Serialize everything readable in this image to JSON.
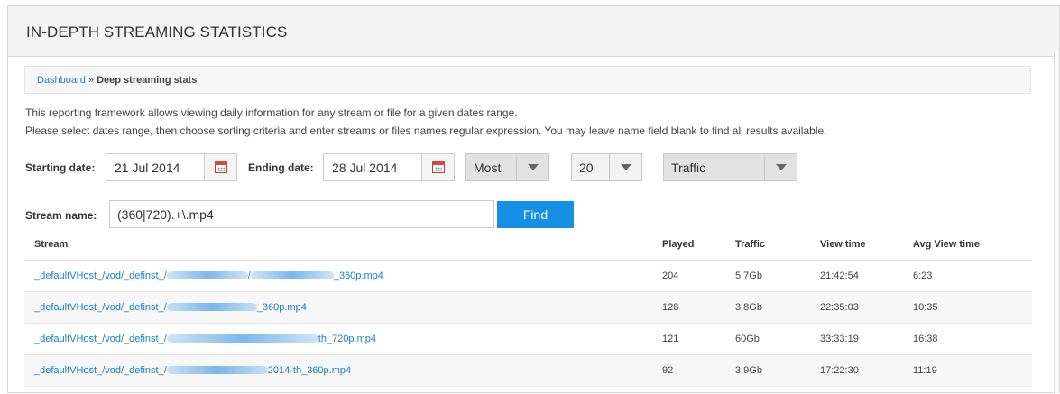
{
  "header": {
    "title": "IN-DEPTH STREAMING STATISTICS"
  },
  "breadcrumb": {
    "home": "Dashboard",
    "separator": "»",
    "current": "Deep streaming stats"
  },
  "description": {
    "line1": "This reporting framework allows viewing daily information for any stream or file for a given dates range.",
    "line2": "Please select dates range, then choose sorting criteria and enter streams or files names regular expression. You may leave name field blank to find all results available."
  },
  "filters": {
    "start_label": "Starting date:",
    "start_value": "21 Jul 2014",
    "end_label": "Ending date:",
    "end_value": "28 Jul 2014",
    "order_value": "Most",
    "count_value": "20",
    "criteria_value": "Traffic",
    "stream_label": "Stream name:",
    "stream_value": "(360|720).+\\.mp4",
    "find_label": "Find"
  },
  "table": {
    "columns": [
      "Stream",
      "Played",
      "Traffic",
      "View time",
      "Avg View time"
    ],
    "rows": [
      {
        "stream_prefix": "_defaultVHost_/vod/_definst_/",
        "stream_suffix": "_360p.mp4",
        "played": "204",
        "traffic": "5.7Gb",
        "view_time": "21:42:54",
        "avg_view_time": "6:23"
      },
      {
        "stream_prefix": "_defaultVHost_/vod/_definst_/",
        "stream_suffix": "_360p.mp4",
        "played": "128",
        "traffic": "3.8Gb",
        "view_time": "22:35:03",
        "avg_view_time": "10:35"
      },
      {
        "stream_prefix": "_defaultVHost_/vod/_definst_/",
        "stream_suffix": "th_720p.mp4",
        "played": "121",
        "traffic": "60Gb",
        "view_time": "33:33:19",
        "avg_view_time": "16:38"
      },
      {
        "stream_prefix": "_defaultVHost_/vod/_definst_/",
        "stream_suffix": "2014-th_360p.mp4",
        "played": "92",
        "traffic": "3.9Gb",
        "view_time": "17:22:30",
        "avg_view_time": "11:19"
      }
    ]
  },
  "colors": {
    "accent": "#1590e4",
    "link": "#1a7fc4"
  }
}
